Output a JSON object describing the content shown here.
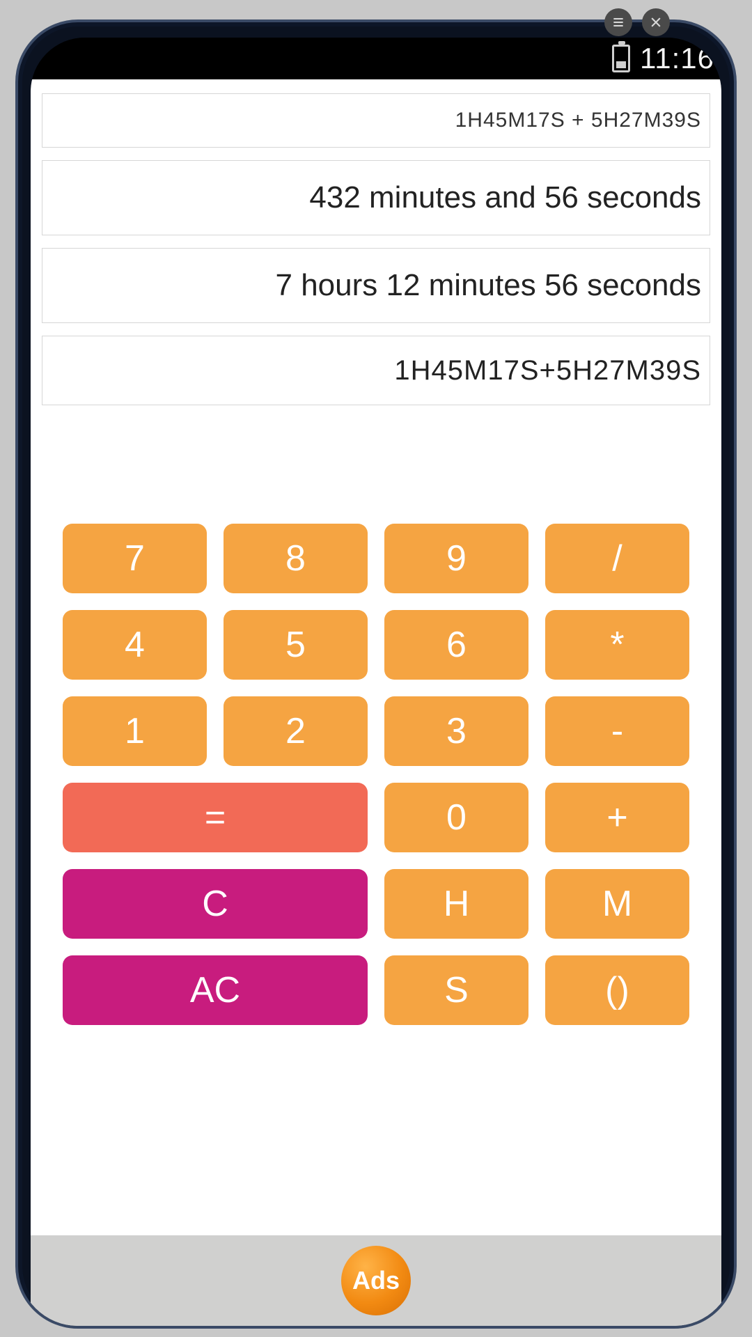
{
  "statusbar": {
    "time": "11:16"
  },
  "display": {
    "expression_small": "1H45M17S + 5H27M39S",
    "result_minutes": "432 minutes and 56 seconds",
    "result_hours": "7 hours 12 minutes 56 seconds",
    "expression_repeat": "1H45M17S+5H27M39S"
  },
  "keys": {
    "k7": "7",
    "k8": "8",
    "k9": "9",
    "div": "/",
    "k4": "4",
    "k5": "5",
    "k6": "6",
    "mul": "*",
    "k1": "1",
    "k2": "2",
    "k3": "3",
    "sub": "-",
    "eq": "=",
    "k0": "0",
    "add": "+",
    "c": "C",
    "h": "H",
    "m": "M",
    "ac": "AC",
    "s": "S",
    "paren": "()"
  },
  "ad": {
    "label": "Ads"
  }
}
